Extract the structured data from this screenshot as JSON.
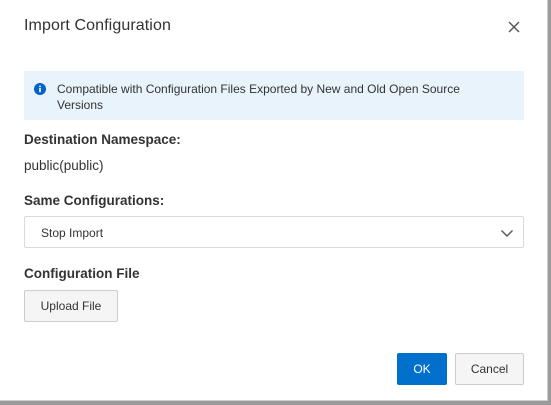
{
  "dialog": {
    "title": "Import Configuration"
  },
  "notice": {
    "text": "Compatible with Configuration Files Exported by New and Old Open Source Versions"
  },
  "namespace": {
    "label": "Destination Namespace:",
    "value": "public(public)"
  },
  "same_config": {
    "label": "Same Configurations:",
    "selected": "Stop Import"
  },
  "config_file": {
    "label": "Configuration File",
    "upload_label": "Upload File"
  },
  "footer": {
    "ok_label": "OK",
    "cancel_label": "Cancel"
  },
  "colors": {
    "primary": "#0070cc",
    "notice_bg": "#e9f3fc",
    "info_icon": "#0064c8"
  },
  "icons": {
    "close": "close-icon",
    "info": "info-icon",
    "dropdown": "chevron-down-icon"
  }
}
